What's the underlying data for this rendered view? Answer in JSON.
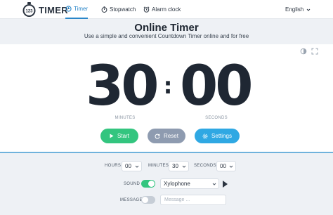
{
  "header": {
    "logo_badge": "123",
    "logo_text": "TIMER",
    "nav": [
      {
        "label": "Timer",
        "icon": "clock-icon",
        "active": true
      },
      {
        "label": "Stopwatch",
        "icon": "stopwatch-icon",
        "active": false
      },
      {
        "label": "Alarm clock",
        "icon": "alarm-clock-icon",
        "active": false
      }
    ],
    "language": "English"
  },
  "title": "Online Timer",
  "subtitle": "Use a simple and convenient Countdown Timer online and for free",
  "toolbar_icons": [
    "theme-toggle-icon",
    "fullscreen-icon"
  ],
  "timer": {
    "minutes": "30",
    "seconds": "00",
    "separator": ":",
    "minutes_label": "MINUTES",
    "seconds_label": "SECONDS"
  },
  "buttons": {
    "start": "Start",
    "reset": "Reset",
    "settings": "Settings"
  },
  "settings": {
    "hours_label": "HOURS",
    "hours_value": "00",
    "minutes_label": "MINUTES",
    "minutes_value": "30",
    "seconds_label": "SECONDS",
    "seconds_value": "00",
    "sound_label": "SOUND",
    "sound_on": true,
    "sound_value": "Xylophone",
    "message_label": "MESSAGE",
    "message_on": false,
    "message_placeholder": "Message ..."
  },
  "colors": {
    "accent": "#2a86c9",
    "start": "#33c57f",
    "reset": "#8e9bb0",
    "settings": "#2fa8e3"
  }
}
